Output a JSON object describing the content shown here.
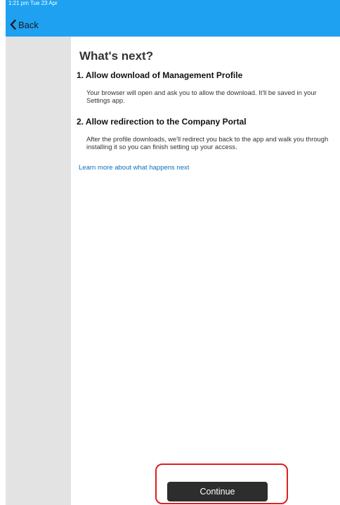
{
  "status_bar": {
    "text": "1:21 pm  Tue 23 Apr"
  },
  "nav": {
    "back_label": "Back"
  },
  "main": {
    "title": "What's next?",
    "steps": [
      {
        "heading": "1. Allow download of Management Profile",
        "body": "Your browser will open and ask you to allow the download. It'll be saved in your Settings app."
      },
      {
        "heading": "2. Allow redirection to the Company Portal",
        "body": "After the profile downloads, we'll redirect you back to the app and walk you through installing it so you can finish setting up your access."
      }
    ],
    "learn_more": "Learn more about what happens next"
  },
  "footer": {
    "continue_label": "Continue"
  },
  "colors": {
    "topbar": "#1ea1f1",
    "sidebar": "#e3e3e3",
    "button": "#2d2d2d",
    "highlight": "#e01f1f",
    "link": "#0d6fb8"
  }
}
